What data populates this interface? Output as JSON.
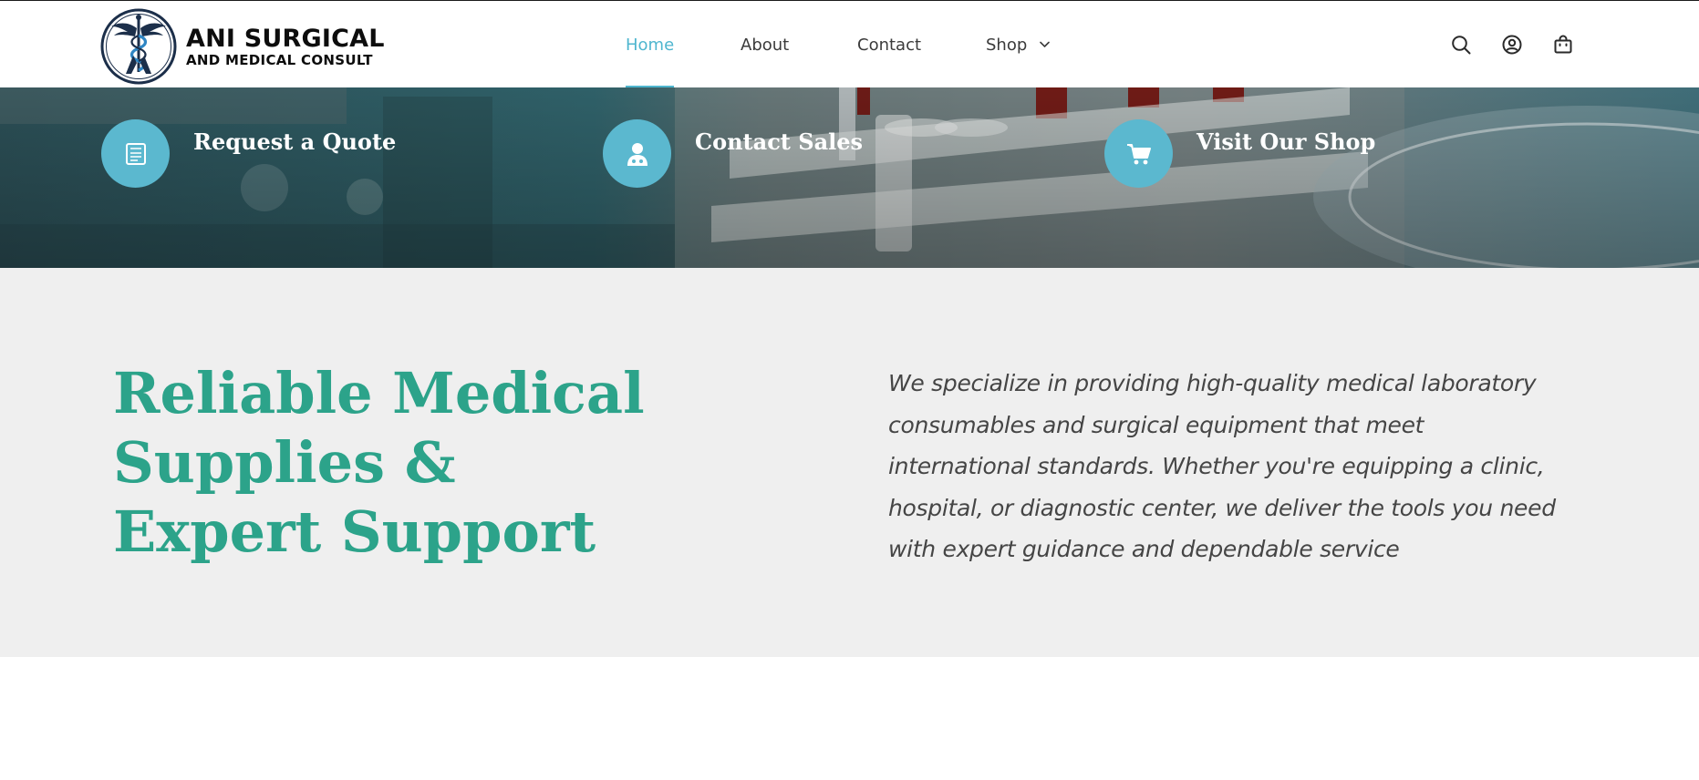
{
  "brand": {
    "name_line1": "ANI SURGICAL",
    "name_line2": "AND MEDICAL CONSULT"
  },
  "nav": {
    "items": [
      {
        "label": "Home",
        "active": true
      },
      {
        "label": "About",
        "active": false
      },
      {
        "label": "Contact",
        "active": false
      },
      {
        "label": "Shop",
        "active": false,
        "has_dropdown": true
      }
    ]
  },
  "header_icons": [
    "search-icon",
    "account-icon",
    "cart-bag-icon"
  ],
  "actions": [
    {
      "label": "Request a Quote",
      "icon": "quote-form-icon"
    },
    {
      "label": "Contact Sales",
      "icon": "sales-agent-icon"
    },
    {
      "label": "Visit Our Shop",
      "icon": "shopping-cart-icon"
    }
  ],
  "intro": {
    "title": "Reliable Medical Supplies & Expert Support",
    "description": "We specialize in providing high-quality medical laboratory consumables and surgical equipment that meet international standards. Whether you're equipping a clinic, hospital, or diagnostic center, we deliver the tools you need with expert guidance and dependable service"
  },
  "colors": {
    "accent": "#4fb6cf",
    "cta_circle": "#5bb8cf",
    "heading_green": "#2ca38a",
    "section_bg": "#efefef",
    "text_dark": "#3b3b3b"
  }
}
